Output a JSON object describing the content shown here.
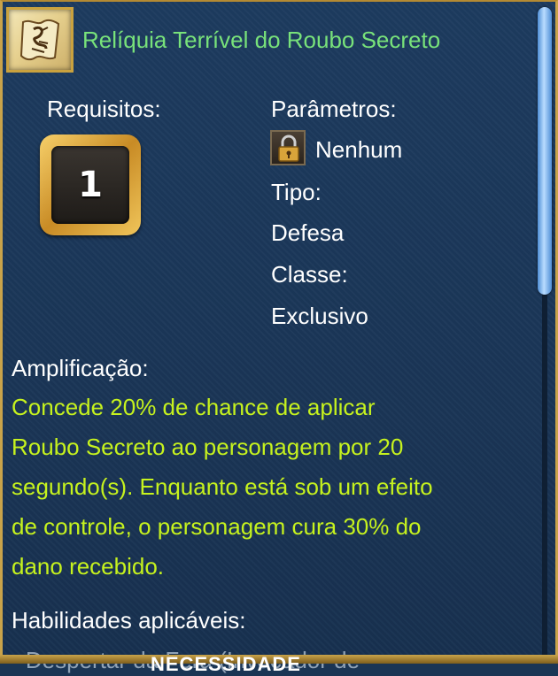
{
  "item": {
    "title": "Relíquia Terrível do Roubo Secreto",
    "icon": "scroll-map-icon"
  },
  "requirements": {
    "label": "Requisitos:",
    "level": "1"
  },
  "parameters": {
    "label": "Parâmetros:",
    "value": "Nenhum",
    "value_icon": "lock-icon",
    "type_label": "Tipo:",
    "type_value": "Defesa",
    "class_label": "Classe:",
    "class_value": "Exclusivo"
  },
  "amplification": {
    "label": "Amplificação:",
    "lines": [
      "Concede 20% de chance de aplicar",
      "Roubo Secreto ao personagem por 20",
      "segundo(s). Enquanto está sob um efeito",
      "de controle, o personagem cura 30% do",
      "dano recebido."
    ]
  },
  "skills": {
    "label": "Habilidades aplicáveis:",
    "first_item": "- Despertar da Fera (Invocador de"
  },
  "bottom": {
    "text": "NECESSIDADE"
  },
  "colors": {
    "title": "#78e27a",
    "description": "#c6f21e",
    "frame_gold": "#c9a34a",
    "background": "#1a3554"
  }
}
